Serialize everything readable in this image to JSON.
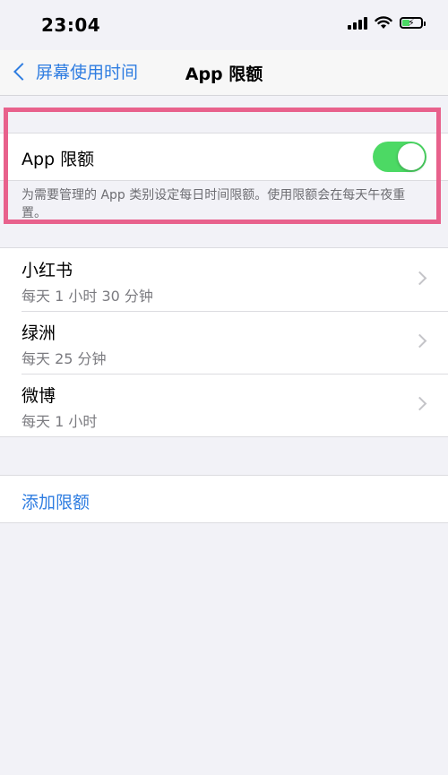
{
  "status_bar": {
    "time": "23:04",
    "wifi_icon": "wifi-icon",
    "battery_icon": "battery-charging-icon"
  },
  "nav": {
    "back_label": "屏幕使用时间",
    "title": "App 限额"
  },
  "limits_section": {
    "toggle_label": "App 限额",
    "toggle_on": true,
    "footnote": "为需要管理的 App 类别设定每日时间限额。使用限额会在每天午夜重置。"
  },
  "apps": [
    {
      "name": "小红书",
      "limit": "每天 1 小时 30 分钟"
    },
    {
      "name": "绿洲",
      "limit": "每天 25 分钟"
    },
    {
      "name": "微博",
      "limit": "每天 1 小时"
    }
  ],
  "add_limit_label": "添加限额",
  "colors": {
    "accent": "#2f7de1",
    "toggle_on": "#4cd964",
    "highlight": "#e8618c"
  }
}
